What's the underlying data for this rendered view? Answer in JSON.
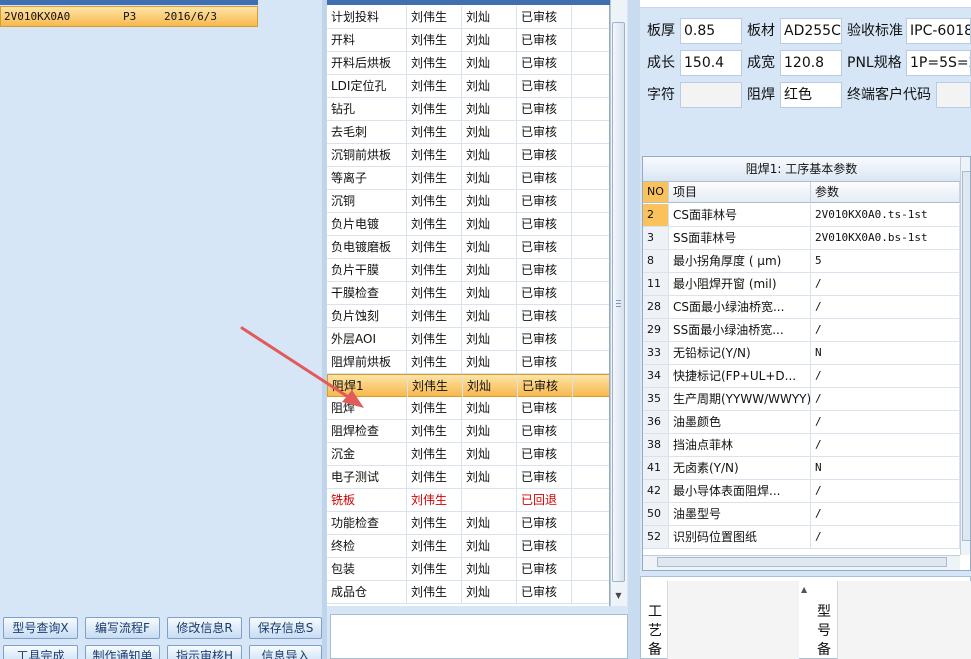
{
  "left": {
    "row": {
      "code": "2V010KX0A0",
      "layer": "P3",
      "date": "2016/6/3"
    },
    "buttons": [
      {
        "label": "型号查询X"
      },
      {
        "label": "编写流程F"
      },
      {
        "label": "修改信息R"
      },
      {
        "label": "保存信息S"
      },
      {
        "label": "工具完成"
      },
      {
        "label": "制作通知单"
      },
      {
        "label": "指示审核H"
      },
      {
        "label": "信息导入"
      }
    ]
  },
  "process_rows": [
    {
      "name": "计划投料",
      "writer": "刘伟生",
      "reviewer": "刘灿",
      "status": "已审核"
    },
    {
      "name": "开料",
      "writer": "刘伟生",
      "reviewer": "刘灿",
      "status": "已审核"
    },
    {
      "name": "开料后烘板",
      "writer": "刘伟生",
      "reviewer": "刘灿",
      "status": "已审核"
    },
    {
      "name": "LDI定位孔",
      "writer": "刘伟生",
      "reviewer": "刘灿",
      "status": "已审核"
    },
    {
      "name": "钻孔",
      "writer": "刘伟生",
      "reviewer": "刘灿",
      "status": "已审核"
    },
    {
      "name": "去毛刺",
      "writer": "刘伟生",
      "reviewer": "刘灿",
      "status": "已审核"
    },
    {
      "name": "沉铜前烘板",
      "writer": "刘伟生",
      "reviewer": "刘灿",
      "status": "已审核"
    },
    {
      "name": "等离子",
      "writer": "刘伟生",
      "reviewer": "刘灿",
      "status": "已审核"
    },
    {
      "name": "沉铜",
      "writer": "刘伟生",
      "reviewer": "刘灿",
      "status": "已审核"
    },
    {
      "name": "负片电镀",
      "writer": "刘伟生",
      "reviewer": "刘灿",
      "status": "已审核"
    },
    {
      "name": "负电镀磨板",
      "writer": "刘伟生",
      "reviewer": "刘灿",
      "status": "已审核"
    },
    {
      "name": "负片干膜",
      "writer": "刘伟生",
      "reviewer": "刘灿",
      "status": "已审核"
    },
    {
      "name": "干膜检查",
      "writer": "刘伟生",
      "reviewer": "刘灿",
      "status": "已审核"
    },
    {
      "name": "负片蚀刻",
      "writer": "刘伟生",
      "reviewer": "刘灿",
      "status": "已审核"
    },
    {
      "name": "外层AOI",
      "writer": "刘伟生",
      "reviewer": "刘灿",
      "status": "已审核"
    },
    {
      "name": "阻焊前烘板",
      "writer": "刘伟生",
      "reviewer": "刘灿",
      "status": "已审核"
    },
    {
      "name": "阻焊1",
      "writer": "刘伟生",
      "reviewer": "刘灿",
      "status": "已审核",
      "selected": true
    },
    {
      "name": "阻焊",
      "writer": "刘伟生",
      "reviewer": "刘灿",
      "status": "已审核"
    },
    {
      "name": "阻焊检查",
      "writer": "刘伟生",
      "reviewer": "刘灿",
      "status": "已审核"
    },
    {
      "name": "沉金",
      "writer": "刘伟生",
      "reviewer": "刘灿",
      "status": "已审核"
    },
    {
      "name": "电子测试",
      "writer": "刘伟生",
      "reviewer": "刘灿",
      "status": "已审核"
    },
    {
      "name": "铣板",
      "writer": "刘伟生",
      "reviewer": "",
      "status": "已回退",
      "rejected": true
    },
    {
      "name": "功能检查",
      "writer": "刘伟生",
      "reviewer": "刘灿",
      "status": "已审核"
    },
    {
      "name": "终检",
      "writer": "刘伟生",
      "reviewer": "刘灿",
      "status": "已审核"
    },
    {
      "name": "包装",
      "writer": "刘伟生",
      "reviewer": "刘灿",
      "status": "已审核"
    },
    {
      "name": "成品仓",
      "writer": "刘伟生",
      "reviewer": "刘灿",
      "status": "已审核"
    }
  ],
  "form": {
    "board_thickness_label": "板厚",
    "board_thickness": "0.85",
    "material_label": "板材",
    "material": "AD255C",
    "standard_label": "验收标准",
    "standard": "IPC-6018",
    "length_label": "成长",
    "length": "150.4",
    "width_label": "成宽",
    "width": "120.8",
    "pnl_label": "PNL规格",
    "pnl": "1P=5S=2",
    "char_label": "字符",
    "char": "",
    "mask_label": "阻焊",
    "mask": "红色",
    "customer_code_label": "终端客户代码",
    "customer_code": ""
  },
  "params": {
    "title": "阻焊1: 工序基本参数",
    "col_no": "NO",
    "col_item": "项目",
    "col_value": "参数",
    "rows": [
      {
        "no": "2",
        "item": "CS面菲林号",
        "value": "2V010KX0A0.ts-1st"
      },
      {
        "no": "3",
        "item": "SS面菲林号",
        "value": "2V010KX0A0.bs-1st"
      },
      {
        "no": "8",
        "item": "最小拐角厚度 ( μm)",
        "value": "5"
      },
      {
        "no": "11",
        "item": "最小阻焊开窗 (mil)",
        "value": "/"
      },
      {
        "no": "28",
        "item": "CS面最小绿油桥宽...",
        "value": "/"
      },
      {
        "no": "29",
        "item": "SS面最小绿油桥宽...",
        "value": "/"
      },
      {
        "no": "33",
        "item": "无铅标记(Y/N)",
        "value": "N"
      },
      {
        "no": "34",
        "item": "快捷标记(FP+UL+D...",
        "value": "/"
      },
      {
        "no": "35",
        "item": "生产周期(YYWW/WWYY)",
        "value": "/"
      },
      {
        "no": "36",
        "item": "油墨颜色",
        "value": "/"
      },
      {
        "no": "38",
        "item": "挡油点菲林",
        "value": "/"
      },
      {
        "no": "41",
        "item": "无卤素(Y/N)",
        "value": "N"
      },
      {
        "no": "42",
        "item": "最小导体表面阻焊...",
        "value": "/"
      },
      {
        "no": "50",
        "item": "油墨型号",
        "value": "/"
      },
      {
        "no": "52",
        "item": "识别码位置图纸",
        "value": "/"
      }
    ]
  },
  "memo": {
    "process_memo_label": "工艺备",
    "model_memo_label": "型号备"
  }
}
